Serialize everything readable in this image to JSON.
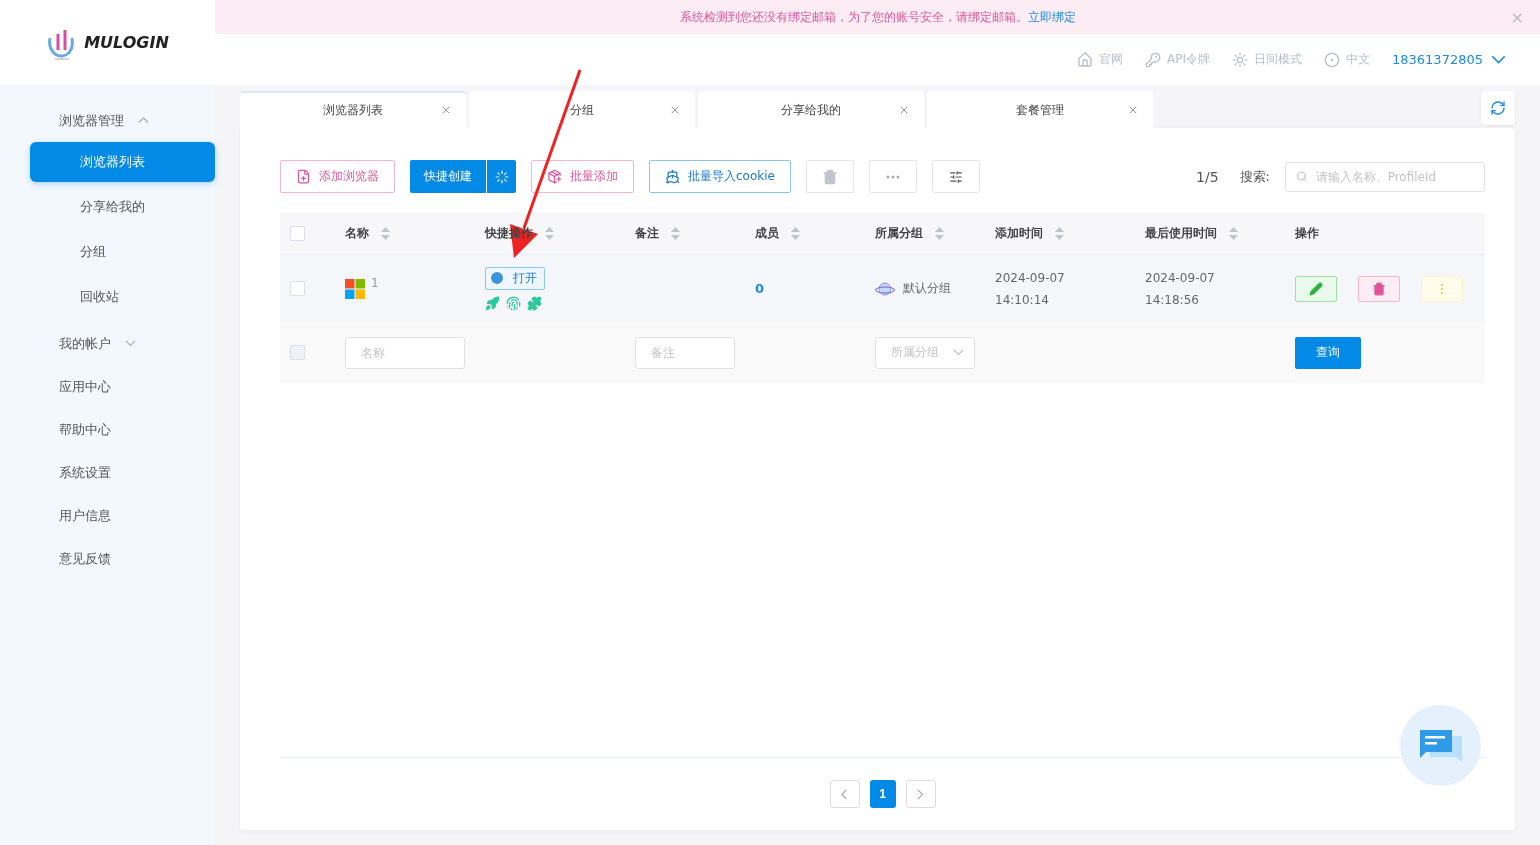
{
  "banner": {
    "message": "系统检测到您还没有绑定邮箱，为了您的账号安全，请绑定邮箱。",
    "link": "立即绑定",
    "close": "×"
  },
  "logo": {
    "text": "MULOGIN"
  },
  "header_links": [
    {
      "kind": "home",
      "label": "官网"
    },
    {
      "kind": "key",
      "label": "API令牌"
    },
    {
      "kind": "sun",
      "label": "日间模式"
    },
    {
      "kind": "globe",
      "label": "中文"
    }
  ],
  "user": {
    "phone": "18361372805"
  },
  "sidebar": {
    "items": [
      {
        "label": "浏览器管理",
        "expanded": true,
        "children": [
          {
            "label": "浏览器列表",
            "selected": true
          },
          {
            "label": "分享给我的",
            "selected": false
          },
          {
            "label": "分组",
            "selected": false
          },
          {
            "label": "回收站",
            "selected": false
          }
        ]
      },
      {
        "label": "我的帐户",
        "expanded": false
      },
      {
        "label": "应用中心"
      },
      {
        "label": "帮助中心"
      },
      {
        "label": "系统设置"
      },
      {
        "label": "用户信息"
      },
      {
        "label": "意见反馈"
      }
    ]
  },
  "tabs": [
    {
      "label": "浏览器列表",
      "selected": true
    },
    {
      "label": "分组",
      "selected": false
    },
    {
      "label": "分享给我的",
      "selected": false
    },
    {
      "label": "套餐管理",
      "selected": false
    }
  ],
  "toolbar": {
    "buttons": [
      {
        "kind": "pink",
        "label": "添加浏览器"
      },
      {
        "kind": "split",
        "label": "快捷创建"
      },
      {
        "kind": "pink",
        "label": "批量添加"
      },
      {
        "kind": "blue",
        "label": "批量导入cookie"
      },
      {
        "kind": "trash"
      },
      {
        "kind": "more"
      },
      {
        "kind": "filter"
      }
    ],
    "page_count": "1/5",
    "search_label": "搜索:",
    "search_placeholder": "请输入名称、ProfileId"
  },
  "table": {
    "header_checked": false,
    "columns": [
      {
        "label": "名称",
        "sortable": true
      },
      {
        "label": "快捷操作",
        "sortable": true
      },
      {
        "label": "备注",
        "sortable": true
      },
      {
        "label": "成员",
        "sortable": true
      },
      {
        "label": "所属分组",
        "sortable": true
      },
      {
        "label": "添加时间",
        "sortable": true
      },
      {
        "label": "最后使用时间",
        "sortable": true
      },
      {
        "label": "操作",
        "sortable": false
      }
    ],
    "rows": [
      {
        "checked": false,
        "name": "1",
        "open_label": "打开",
        "members": "0",
        "group": "默认分组",
        "added_date": "2024-09-07",
        "added_time": "14:10:14",
        "used_date": "2024-09-07",
        "used_time": "14:18:56"
      }
    ],
    "filter": {
      "checkbox_disabled": true,
      "name_placeholder": "名称",
      "note_placeholder": "备注",
      "group_placeholder": "所属分组",
      "query": "查询"
    }
  },
  "pagination": {
    "pages": [
      {
        "label": "1",
        "selected": true
      }
    ]
  }
}
